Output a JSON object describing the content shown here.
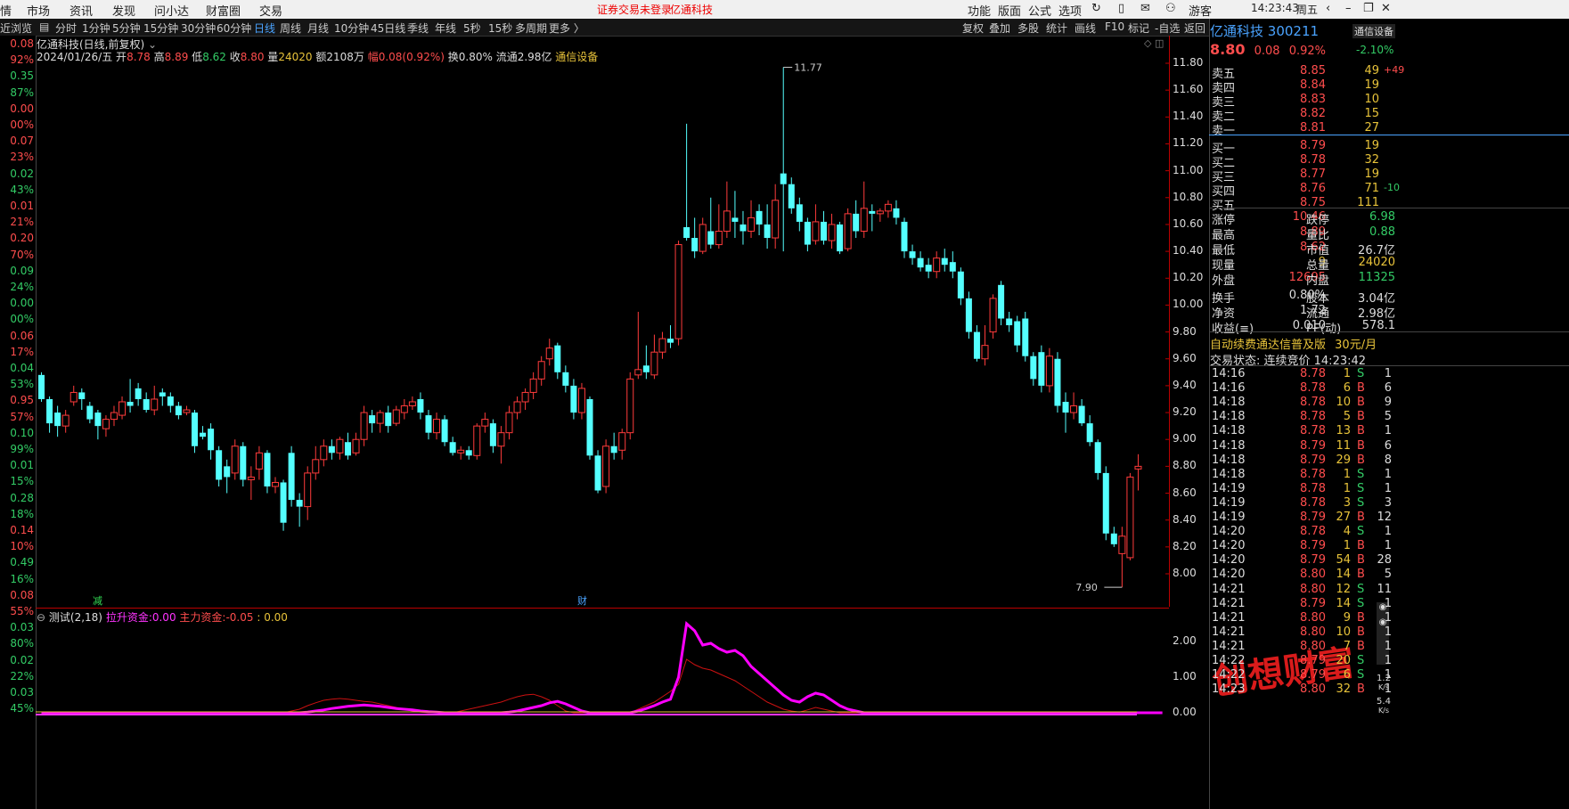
{
  "menu": {
    "items": [
      "市场",
      "资讯",
      "发现",
      "问小达",
      "财富圈",
      "交易"
    ],
    "notice": "证券交易未登录",
    "stock": "亿通科技",
    "right": [
      "功能",
      "版面",
      "公式",
      "选项"
    ],
    "user": "游客",
    "time": "14:23:43",
    "weekday": "周五"
  },
  "toolbar": {
    "periods": [
      "分时",
      "1分钟",
      "5分钟",
      "15分钟",
      "30分钟",
      "60分钟",
      "日线",
      "周线",
      "月线",
      "10分钟",
      "45日线",
      "季线",
      "年线",
      "5秒",
      "15秒",
      "多周期",
      "更多 〉"
    ],
    "active": "日线",
    "tools": [
      "复权",
      "叠加",
      "多股",
      "统计",
      "画线",
      "F10",
      "标记",
      "-自选",
      "返回"
    ],
    "left": "近浏览"
  },
  "chart": {
    "title": "亿通科技(日线,前复权)",
    "date": "2024/01/26/五",
    "open_label": "开",
    "open": "8.78",
    "high_label": "高",
    "high": "8.89",
    "low_label": "低",
    "low": "8.62",
    "close_label": "收",
    "close": "8.80",
    "vol_label": "量",
    "vol": "24020",
    "amt": "额2108万",
    "chg": "幅0.08(0.92%)",
    "turnover": "换0.80%",
    "float": "流通2.98亿",
    "sector": "通信设备",
    "max_label": "11.77",
    "min_label": "7.90",
    "marker1": "减",
    "marker2": "财",
    "yticks": [
      "11.80",
      "11.60",
      "11.40",
      "11.20",
      "11.00",
      "10.80",
      "10.60",
      "10.40",
      "10.20",
      "10.00",
      "9.80",
      "9.60",
      "9.40",
      "9.20",
      "9.00",
      "8.80",
      "8.60",
      "8.40",
      "8.20",
      "8.00"
    ]
  },
  "indicator": {
    "name": "测试(2,18)",
    "l1": "拉升资金:",
    "v1": "0.00",
    "l2": "主力资金:",
    "v2": "-0.05",
    "v3": ": 0.00",
    "yticks": [
      "2.00",
      "1.00",
      "0.00"
    ]
  },
  "leftvals": [
    "0.08",
    "92%",
    "0.35",
    "87%",
    "0.00",
    "00%",
    "0.07",
    "23%",
    "0.02",
    "43%",
    "0.01",
    "21%",
    "0.20",
    "70%",
    "0.09",
    "24%",
    "0.00",
    "00%",
    "0.06",
    "17%",
    "0.04",
    "53%",
    "0.95",
    "57%",
    "0.10",
    "99%",
    "0.01",
    "15%",
    "0.28",
    "18%",
    "0.14",
    "10%",
    "0.49",
    "16%",
    "0.08",
    "55%",
    "0.03",
    "80%",
    "0.02",
    "22%",
    "0.03",
    "45%"
  ],
  "quote": {
    "name": "亿通科技",
    "code": "300211",
    "sector": "通信设备",
    "price": "8.80",
    "chg": "0.08",
    "pct": "0.92%",
    "sector_pct": "-2.10%",
    "asks": [
      {
        "l": "卖五",
        "p": "8.85",
        "v": "49",
        "x": "+49"
      },
      {
        "l": "卖四",
        "p": "8.84",
        "v": "19",
        "x": ""
      },
      {
        "l": "卖三",
        "p": "8.83",
        "v": "10",
        "x": ""
      },
      {
        "l": "卖二",
        "p": "8.82",
        "v": "15",
        "x": ""
      },
      {
        "l": "卖一",
        "p": "8.81",
        "v": "27",
        "x": ""
      }
    ],
    "bids": [
      {
        "l": "买一",
        "p": "8.79",
        "v": "19",
        "x": ""
      },
      {
        "l": "买二",
        "p": "8.78",
        "v": "32",
        "x": ""
      },
      {
        "l": "买三",
        "p": "8.77",
        "v": "19",
        "x": ""
      },
      {
        "l": "买四",
        "p": "8.76",
        "v": "71",
        "x": "-10"
      },
      {
        "l": "买五",
        "p": "8.75",
        "v": "111",
        "x": ""
      }
    ],
    "stats": [
      [
        "涨停",
        "10.46",
        "跌停",
        "6.98"
      ],
      [
        "最高",
        "8.89",
        "量比",
        "0.88"
      ],
      [
        "最低",
        "8.62",
        "市值",
        "26.7亿"
      ],
      [
        "现量",
        "9",
        "总量",
        "24020"
      ],
      [
        "外盘",
        "12695",
        "内盘",
        "11325"
      ],
      [
        "换手",
        "0.80%",
        "股本",
        "3.04亿"
      ],
      [
        "净资",
        "1.72",
        "流通",
        "2.98亿"
      ],
      [
        "收益(≡)",
        "0.010",
        "PE(动)",
        "578.1"
      ]
    ],
    "ad": "自动续费通达信普及版",
    "ad_price": "30元/月",
    "status": "交易状态: 连续竞价 14:23:42",
    "ticks": [
      [
        "14:16",
        "8.78",
        "1",
        "S",
        "1"
      ],
      [
        "14:16",
        "8.78",
        "6",
        "B",
        "6"
      ],
      [
        "14:18",
        "8.78",
        "10",
        "B",
        "9"
      ],
      [
        "14:18",
        "8.78",
        "5",
        "B",
        "5"
      ],
      [
        "14:18",
        "8.78",
        "13",
        "B",
        "1"
      ],
      [
        "14:18",
        "8.79",
        "11",
        "B",
        "6"
      ],
      [
        "14:18",
        "8.79",
        "29",
        "B",
        "8"
      ],
      [
        "14:18",
        "8.78",
        "1",
        "S",
        "1"
      ],
      [
        "14:19",
        "8.78",
        "1",
        "S",
        "1"
      ],
      [
        "14:19",
        "8.78",
        "3",
        "S",
        "3"
      ],
      [
        "14:19",
        "8.79",
        "27",
        "B",
        "12"
      ],
      [
        "14:20",
        "8.78",
        "4",
        "S",
        "1"
      ],
      [
        "14:20",
        "8.79",
        "1",
        "B",
        "1"
      ],
      [
        "14:20",
        "8.79",
        "54",
        "B",
        "28"
      ],
      [
        "14:20",
        "8.80",
        "14",
        "B",
        "5"
      ],
      [
        "14:21",
        "8.80",
        "12",
        "S",
        "11"
      ],
      [
        "14:21",
        "8.79",
        "14",
        "S",
        "1"
      ],
      [
        "14:21",
        "8.80",
        "9",
        "B",
        "1"
      ],
      [
        "14:21",
        "8.80",
        "10",
        "B",
        "1"
      ],
      [
        "14:21",
        "8.80",
        "7",
        "B",
        "1"
      ],
      [
        "14:22",
        "8.79",
        "20",
        "S",
        "1"
      ],
      [
        "14:22",
        "8.79",
        "6",
        "S",
        "1"
      ],
      [
        "14:23",
        "8.80",
        "32",
        "B",
        "1"
      ]
    ],
    "speed1": "1.2",
    "speed2": "5.4",
    "speed_unit": "K/s",
    "watermark": "创想财富"
  },
  "colors": {
    "up": "#ff3b3b",
    "down": "#54ffff",
    "ma": "#ff00ff"
  },
  "candles": [
    [
      9.48,
      9.3,
      9.5,
      9.28
    ],
    [
      9.3,
      9.12,
      9.32,
      9.05
    ],
    [
      9.2,
      9.1,
      9.25,
      9.02
    ],
    [
      9.1,
      9.18,
      9.22,
      9.05
    ],
    [
      9.28,
      9.35,
      9.4,
      9.25
    ],
    [
      9.35,
      9.3,
      9.38,
      9.22
    ],
    [
      9.25,
      9.15,
      9.28,
      9.12
    ],
    [
      9.2,
      9.1,
      9.22,
      9.0
    ],
    [
      9.08,
      9.15,
      9.18,
      9.02
    ],
    [
      9.15,
      9.2,
      9.25,
      9.1
    ],
    [
      9.18,
      9.28,
      9.32,
      9.15
    ],
    [
      9.28,
      9.25,
      9.45,
      9.2
    ],
    [
      9.38,
      9.3,
      9.42,
      9.25
    ],
    [
      9.3,
      9.22,
      9.35,
      9.2
    ],
    [
      9.22,
      9.3,
      9.4,
      9.18
    ],
    [
      9.35,
      9.32,
      9.38,
      9.25
    ],
    [
      9.32,
      9.25,
      9.35,
      9.2
    ],
    [
      9.25,
      9.18,
      9.28,
      9.15
    ],
    [
      9.2,
      9.22,
      9.25,
      9.18
    ],
    [
      9.2,
      8.95,
      9.22,
      8.9
    ],
    [
      9.05,
      9.02,
      9.1,
      9.0
    ],
    [
      9.08,
      8.92,
      9.12,
      8.85
    ],
    [
      8.92,
      8.7,
      8.95,
      8.65
    ],
    [
      8.8,
      8.72,
      8.85,
      8.6
    ],
    [
      8.75,
      8.95,
      9.0,
      8.7
    ],
    [
      8.95,
      8.7,
      8.98,
      8.65
    ],
    [
      8.7,
      8.72,
      8.8,
      8.55
    ],
    [
      8.78,
      8.9,
      8.95,
      8.7
    ],
    [
      8.9,
      8.65,
      8.92,
      8.6
    ],
    [
      8.65,
      8.68,
      8.72,
      8.6
    ],
    [
      8.68,
      8.38,
      8.7,
      8.32
    ],
    [
      8.9,
      8.55,
      8.95,
      8.5
    ],
    [
      8.55,
      8.5,
      8.6,
      8.35
    ],
    [
      8.5,
      8.75,
      8.8,
      8.4
    ],
    [
      8.75,
      8.85,
      8.95,
      8.7
    ],
    [
      8.85,
      8.95,
      9.0,
      8.8
    ],
    [
      8.95,
      8.9,
      9.0,
      8.85
    ],
    [
      8.9,
      9.0,
      9.02,
      8.85
    ],
    [
      8.98,
      8.88,
      9.05,
      8.85
    ],
    [
      8.9,
      9.0,
      9.05,
      8.88
    ],
    [
      9.0,
      9.2,
      9.25,
      8.95
    ],
    [
      9.18,
      9.12,
      9.22,
      9.05
    ],
    [
      9.12,
      9.2,
      9.22,
      9.05
    ],
    [
      9.2,
      9.1,
      9.25,
      9.05
    ],
    [
      9.12,
      9.22,
      9.25,
      9.1
    ],
    [
      9.2,
      9.25,
      9.3,
      9.15
    ],
    [
      9.25,
      9.28,
      9.32,
      9.22
    ],
    [
      9.3,
      9.2,
      9.35,
      9.15
    ],
    [
      9.18,
      9.05,
      9.22,
      9.0
    ],
    [
      9.05,
      9.15,
      9.2,
      9.0
    ],
    [
      9.15,
      8.98,
      9.18,
      8.95
    ],
    [
      8.98,
      8.9,
      9.02,
      8.88
    ],
    [
      8.9,
      8.92,
      8.95,
      8.85
    ],
    [
      8.92,
      8.88,
      8.95,
      8.85
    ],
    [
      8.88,
      9.1,
      9.12,
      8.85
    ],
    [
      9.1,
      9.15,
      9.2,
      9.05
    ],
    [
      9.12,
      8.95,
      9.15,
      8.9
    ],
    [
      8.95,
      9.05,
      9.1,
      8.82
    ],
    [
      9.05,
      9.2,
      9.25,
      9.0
    ],
    [
      9.2,
      9.28,
      9.32,
      9.15
    ],
    [
      9.28,
      9.35,
      9.38,
      9.22
    ],
    [
      9.35,
      9.45,
      9.5,
      9.3
    ],
    [
      9.45,
      9.58,
      9.62,
      9.4
    ],
    [
      9.6,
      9.68,
      9.75,
      9.55
    ],
    [
      9.7,
      9.5,
      9.72,
      9.45
    ],
    [
      9.5,
      9.4,
      9.55,
      9.35
    ],
    [
      9.4,
      9.2,
      9.45,
      9.15
    ],
    [
      9.2,
      9.38,
      9.42,
      9.15
    ],
    [
      9.3,
      8.88,
      9.32,
      8.85
    ],
    [
      8.88,
      8.62,
      8.92,
      8.6
    ],
    [
      8.65,
      8.95,
      9.0,
      8.6
    ],
    [
      8.95,
      8.9,
      9.05,
      8.85
    ],
    [
      8.92,
      9.05,
      9.08,
      8.85
    ],
    [
      9.05,
      9.45,
      9.5,
      9.0
    ],
    [
      9.48,
      9.52,
      9.95,
      9.45
    ],
    [
      9.55,
      9.5,
      9.7,
      9.45
    ],
    [
      9.48,
      9.65,
      9.78,
      9.45
    ],
    [
      9.65,
      9.75,
      9.8,
      9.6
    ],
    [
      9.75,
      9.72,
      9.85,
      9.68
    ],
    [
      9.75,
      10.45,
      10.48,
      9.7
    ],
    [
      10.58,
      10.5,
      11.35,
      10.48
    ],
    [
      10.5,
      10.4,
      10.65,
      10.35
    ],
    [
      10.4,
      10.6,
      10.65,
      10.38
    ],
    [
      10.55,
      10.45,
      10.8,
      10.42
    ],
    [
      10.45,
      10.55,
      10.75,
      10.42
    ],
    [
      10.55,
      10.7,
      10.92,
      10.5
    ],
    [
      10.65,
      10.62,
      10.85,
      10.5
    ],
    [
      10.6,
      10.55,
      10.7,
      10.45
    ],
    [
      10.55,
      10.65,
      10.78,
      10.5
    ],
    [
      10.7,
      10.6,
      10.75,
      10.52
    ],
    [
      10.6,
      10.5,
      10.75,
      10.42
    ],
    [
      10.5,
      10.78,
      10.9,
      10.42
    ],
    [
      10.98,
      10.9,
      11.77,
      10.4
    ],
    [
      10.9,
      10.72,
      10.95,
      10.68
    ],
    [
      10.75,
      10.62,
      10.8,
      10.55
    ],
    [
      10.62,
      10.45,
      10.65,
      10.4
    ],
    [
      10.48,
      10.62,
      10.75,
      10.45
    ],
    [
      10.62,
      10.48,
      10.7,
      10.45
    ],
    [
      10.48,
      10.6,
      10.68,
      10.42
    ],
    [
      10.6,
      10.4,
      10.62,
      10.38
    ],
    [
      10.42,
      10.68,
      10.72,
      10.4
    ],
    [
      10.68,
      10.55,
      10.78,
      10.5
    ],
    [
      10.55,
      10.72,
      10.92,
      10.5
    ],
    [
      10.7,
      10.68,
      10.75,
      10.55
    ],
    [
      10.68,
      10.7,
      10.72,
      10.62
    ],
    [
      10.7,
      10.75,
      10.78,
      10.65
    ],
    [
      10.72,
      10.65,
      10.78,
      10.6
    ],
    [
      10.62,
      10.4,
      10.65,
      10.35
    ],
    [
      10.4,
      10.35,
      10.45,
      10.3
    ],
    [
      10.35,
      10.28,
      10.4,
      10.25
    ],
    [
      10.3,
      10.25,
      10.35,
      10.2
    ],
    [
      10.25,
      10.35,
      10.4,
      10.2
    ],
    [
      10.35,
      10.3,
      10.42,
      10.25
    ],
    [
      10.32,
      10.25,
      10.4,
      10.2
    ],
    [
      10.25,
      10.05,
      10.28,
      10.0
    ],
    [
      10.05,
      9.8,
      10.1,
      9.75
    ],
    [
      9.8,
      9.6,
      9.85,
      9.58
    ],
    [
      9.6,
      9.7,
      9.85,
      9.55
    ],
    [
      9.8,
      10.05,
      10.08,
      9.75
    ],
    [
      10.15,
      9.9,
      10.18,
      9.85
    ],
    [
      9.9,
      9.85,
      9.95,
      9.8
    ],
    [
      9.88,
      9.7,
      9.92,
      9.65
    ],
    [
      9.9,
      9.62,
      9.95,
      9.58
    ],
    [
      9.62,
      9.45,
      9.65,
      9.4
    ],
    [
      9.65,
      9.4,
      9.7,
      9.35
    ],
    [
      9.4,
      9.62,
      9.68,
      9.35
    ],
    [
      9.6,
      9.25,
      9.65,
      9.2
    ],
    [
      9.28,
      9.2,
      9.35,
      9.05
    ],
    [
      9.2,
      9.25,
      9.35,
      9.15
    ],
    [
      9.25,
      9.12,
      9.3,
      9.1
    ],
    [
      9.12,
      8.98,
      9.18,
      8.95
    ],
    [
      8.98,
      8.75,
      9.0,
      8.7
    ],
    [
      8.75,
      8.3,
      8.8,
      8.25
    ],
    [
      8.3,
      8.22,
      8.35,
      8.2
    ],
    [
      8.15,
      8.28,
      8.35,
      7.9
    ],
    [
      8.12,
      8.72,
      8.75,
      8.1
    ],
    [
      8.78,
      8.8,
      8.89,
      8.62
    ]
  ],
  "ind_magenta": [
    0.0,
    0.0,
    0.0,
    0.0,
    0.0,
    0.0,
    0.0,
    0.0,
    0.0,
    0.0,
    0.0,
    0.0,
    0.0,
    0.0,
    0.0,
    0.0,
    0.0,
    0.0,
    0.0,
    0.0,
    0.0,
    0.0,
    0.0,
    0.0,
    0.0,
    0.0,
    0.0,
    0.0,
    0.0,
    0.0,
    0.0,
    0.0,
    0.0,
    0.02,
    0.05,
    0.08,
    0.12,
    0.15,
    0.18,
    0.2,
    0.22,
    0.2,
    0.18,
    0.15,
    0.12,
    0.1,
    0.08,
    0.05,
    0.03,
    0.02,
    0.0,
    0.0,
    0.0,
    0.0,
    0.0,
    0.0,
    0.0,
    0.0,
    0.02,
    0.05,
    0.1,
    0.15,
    0.2,
    0.28,
    0.32,
    0.25,
    0.15,
    0.05,
    0.0,
    0.0,
    0.0,
    0.0,
    0.0,
    0.0,
    0.05,
    0.12,
    0.2,
    0.3,
    0.38,
    1.0,
    2.5,
    2.3,
    1.9,
    1.95,
    1.8,
    1.7,
    1.75,
    1.6,
    1.3,
    1.1,
    0.9,
    0.7,
    0.5,
    0.35,
    0.3,
    0.45,
    0.55,
    0.5,
    0.35,
    0.2,
    0.1,
    0.05,
    0.0,
    0.0,
    0.0,
    0.0,
    0.0,
    0.0,
    0.0,
    0.0,
    0.0,
    0.0,
    0.0,
    0.0,
    0.0,
    0.0,
    0.0,
    0.0,
    0.0,
    0.0,
    0.0,
    0.0,
    0.0,
    0.0,
    0.0,
    0.0,
    0.0,
    0.0,
    0.0,
    0.0,
    0.0,
    0.0,
    0.0,
    0.0,
    0.0,
    0.0,
    0.0,
    0.0,
    0.0,
    0.0
  ],
  "ind_red": [
    0.0,
    0.0,
    0.0,
    0.0,
    0.0,
    0.0,
    0.0,
    0.0,
    0.0,
    0.0,
    0.0,
    0.0,
    0.0,
    0.0,
    0.0,
    0.0,
    0.0,
    0.0,
    0.0,
    0.0,
    0.0,
    0.0,
    0.0,
    0.0,
    0.0,
    0.0,
    0.0,
    0.0,
    0.0,
    0.0,
    0.0,
    0.05,
    0.1,
    0.2,
    0.28,
    0.35,
    0.38,
    0.4,
    0.38,
    0.35,
    0.32,
    0.3,
    0.25,
    0.2,
    0.15,
    0.1,
    0.05,
    0.02,
    0.0,
    0.0,
    0.0,
    0.0,
    0.05,
    0.1,
    0.15,
    0.2,
    0.25,
    0.3,
    0.38,
    0.45,
    0.5,
    0.52,
    0.45,
    0.35,
    0.2,
    0.05,
    0.0,
    0.0,
    0.0,
    0.0,
    0.0,
    0.0,
    0.0,
    0.0,
    0.1,
    0.2,
    0.3,
    0.45,
    0.6,
    0.8,
    1.5,
    1.35,
    1.25,
    1.2,
    1.1,
    1.0,
    0.9,
    0.75,
    0.6,
    0.45,
    0.3,
    0.2,
    0.1,
    0.05,
    0.02,
    0.08,
    0.15,
    0.1,
    0.05,
    0.0,
    0.0,
    0.0,
    0.0,
    0.0,
    0.0,
    0.0,
    0.0,
    0.0,
    0.0,
    0.0,
    0.0,
    0.0,
    0.0,
    0.0,
    0.0,
    0.0,
    0.0,
    0.0,
    0.0,
    0.0,
    0.0,
    0.0,
    0.0,
    0.0,
    0.0,
    0.0,
    0.0,
    0.0,
    0.0,
    0.0,
    0.0,
    0.0,
    0.0,
    0.0,
    0.0,
    0.0,
    0.0,
    0.0,
    0.0
  ]
}
